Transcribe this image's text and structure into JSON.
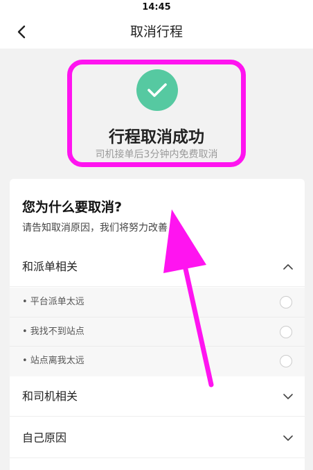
{
  "status_bar": {
    "time": "14:45"
  },
  "nav": {
    "title": "取消行程",
    "back_icon": "chevron-left-icon"
  },
  "success": {
    "title": "行程取消成功",
    "subtitle": "司机接单后3分钟内免费取消",
    "icon": "check-icon",
    "color": "#56c9a1"
  },
  "reasons": {
    "title": "您为什么要取消?",
    "subtitle": "请告知取消原因，我们将努力改善",
    "groups": [
      {
        "label": "和派单相关",
        "expanded": true,
        "items": [
          "• 平台派单太远",
          "• 我找不到站点",
          "• 站点离我太远"
        ]
      },
      {
        "label": "和司机相关",
        "expanded": false
      },
      {
        "label": "自己原因",
        "expanded": false
      }
    ]
  },
  "annotation": {
    "color": "#ff14f0"
  }
}
